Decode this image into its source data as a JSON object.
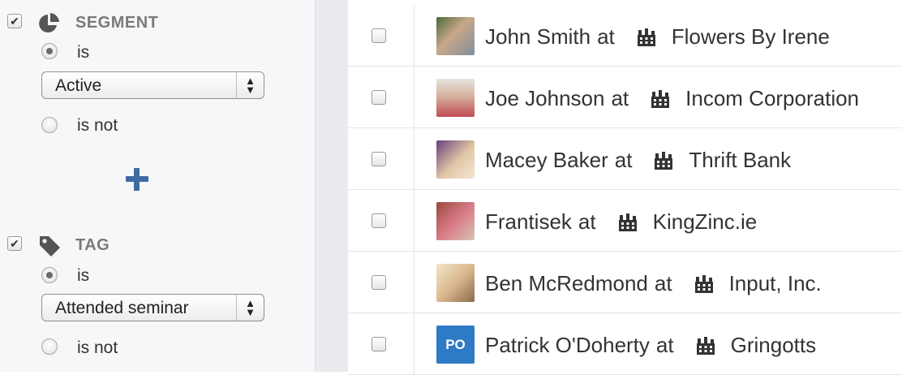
{
  "filters": {
    "segment": {
      "label": "SEGMENT",
      "checked": true,
      "icon": "pie-chart-icon",
      "is_label": "is",
      "is_not_label": "is not",
      "selected_option": "is",
      "select_value": "Active"
    },
    "tag": {
      "label": "TAG",
      "checked": true,
      "icon": "tag-icon",
      "is_label": "is",
      "is_not_label": "is not",
      "selected_option": "is",
      "select_value": "Attended seminar"
    },
    "add_icon": "plus-icon"
  },
  "contacts": [
    {
      "name": "John Smith",
      "at": "at",
      "company": "Flowers By Irene",
      "avatar": "photo"
    },
    {
      "name": "Joe Johnson",
      "at": "at",
      "company": "Incom Corporation",
      "avatar": "photo"
    },
    {
      "name": "Macey Baker",
      "at": "at",
      "company": "Thrift Bank",
      "avatar": "photo"
    },
    {
      "name": "Frantisek",
      "at": "at",
      "company": "KingZinc.ie",
      "avatar": "photo"
    },
    {
      "name": "Ben McRedmond",
      "at": "at",
      "company": "Input, Inc.",
      "avatar": "photo"
    },
    {
      "name": "Patrick O'Doherty",
      "at": "at",
      "company": "Gringotts",
      "avatar": "initials",
      "initials": "PO"
    }
  ],
  "colors": {
    "accent": "#3f6aa3",
    "initials_avatar": "#2f7ac4"
  }
}
